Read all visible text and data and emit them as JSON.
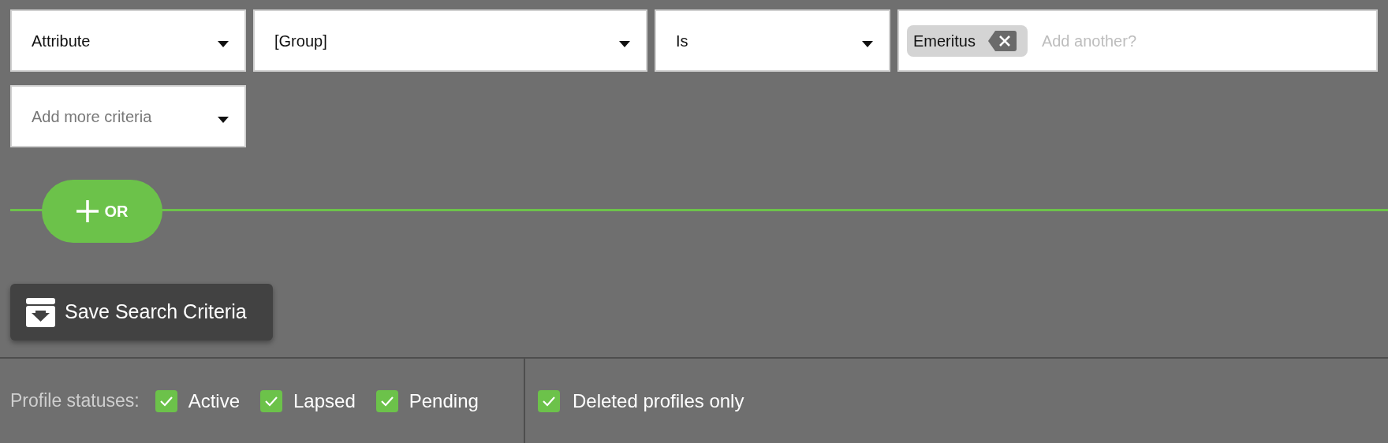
{
  "criteria_row": [
    {
      "kind": "select",
      "value": "Attribute",
      "placeholder_shown": false
    },
    {
      "kind": "select",
      "value": "[Group]",
      "placeholder_shown": false
    },
    {
      "kind": "select",
      "value": "Is",
      "placeholder_shown": false
    },
    {
      "kind": "tags",
      "tags": [
        "Emeritus"
      ],
      "placeholder": "Add another?"
    }
  ],
  "add_more": {
    "placeholder": "Add more criteria"
  },
  "or_button": {
    "label": "OR"
  },
  "save_button": {
    "label": "Save Search Criteria"
  },
  "status_bar": {
    "label": "Profile statuses:",
    "statuses": [
      {
        "label": "Active",
        "checked": true
      },
      {
        "label": "Lapsed",
        "checked": true
      },
      {
        "label": "Pending",
        "checked": true
      }
    ],
    "deleted": {
      "label": "Deleted profiles only",
      "checked": true
    }
  }
}
